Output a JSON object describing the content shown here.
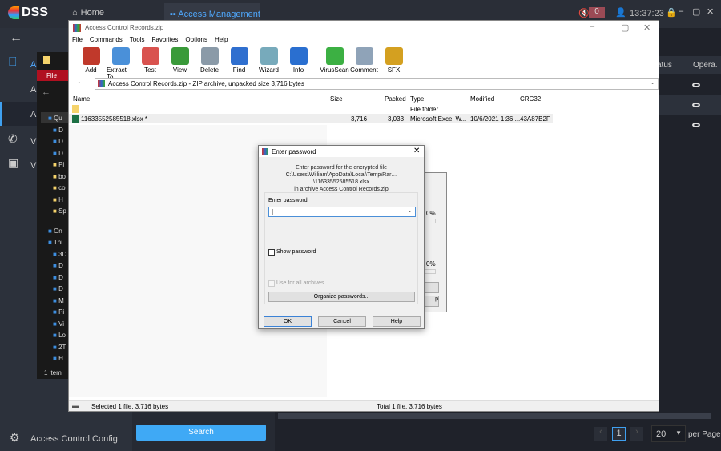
{
  "dss": {
    "logo": "DSS",
    "nav": {
      "home": "Home",
      "access": "Access Management"
    },
    "alarm_count": "0",
    "time": "13:37:23",
    "sidebar": {
      "items": [
        "A",
        "A",
        "A",
        "V",
        "V"
      ],
      "config": "Access Control Config"
    },
    "table": {
      "headers": [
        "atus",
        "Opera."
      ]
    },
    "search_label": "Search",
    "pagination": {
      "page": "1",
      "per_page_value": "20",
      "per_page_label": "per Page"
    }
  },
  "explorer": {
    "file_tab": "File",
    "status": "1 item",
    "items": [
      "Qu",
      "D",
      "D",
      "D",
      "Pi",
      "bo",
      "co",
      "H",
      "Sp",
      "On",
      "Thi",
      "3D",
      "D",
      "D",
      "D",
      "M",
      "Pi",
      "Vi",
      "Lo",
      "2T",
      "H"
    ]
  },
  "winrar": {
    "title": "Access Control Records.zip",
    "menu": [
      "File",
      "Commands",
      "Tools",
      "Favorites",
      "Options",
      "Help"
    ],
    "toolbar": [
      {
        "label": "Add",
        "color": "#c0392b"
      },
      {
        "label": "Extract To",
        "color": "#4a90d9"
      },
      {
        "label": "Test",
        "color": "#d9534f"
      },
      {
        "label": "View",
        "color": "#3a9a3a"
      },
      {
        "label": "Delete",
        "color": "#8a9aa8"
      },
      {
        "label": "Find",
        "color": "#2f6fcf"
      },
      {
        "label": "Wizard",
        "color": "#7ab"
      },
      {
        "label": "Info",
        "color": "#2a6fd0"
      },
      {
        "label": "VirusScan",
        "color": "#3cb043"
      },
      {
        "label": "Comment",
        "color": "#8fa3b8"
      },
      {
        "label": "SFX",
        "color": "#d4a020"
      }
    ],
    "address": "Access Control Records.zip - ZIP archive, unpacked size 3,716 bytes",
    "columns": [
      "Name",
      "Size",
      "Packed",
      "Type",
      "Modified",
      "CRC32"
    ],
    "rows": [
      {
        "name": "..",
        "size": "",
        "packed": "",
        "type": "File folder",
        "modified": "",
        "crc": ""
      },
      {
        "name": "11633552585518.xlsx *",
        "size": "3,716",
        "packed": "3,033",
        "type": "Microsoft Excel W...",
        "modified": "10/6/2021 1:36 ...",
        "crc": "43A87B2F"
      }
    ],
    "status_left": "Selected 1 file, 3,716 bytes",
    "status_right": "Total 1 file, 3,716 bytes"
  },
  "progress": {
    "pct1": "0%",
    "pct2": "0%"
  },
  "dialog": {
    "title": "Enter password",
    "line1": "Enter password for the encrypted file",
    "line2": "C:\\Users\\William\\AppData\\Local\\Temp\\Rar…\\11633552585518.xlsx",
    "line3": "in archive Access Control Records.zip",
    "field_label": "Enter password",
    "password_value": "",
    "show_password": "Show password",
    "use_all": "Use for all archives",
    "organize": "Organize passwords...",
    "ok": "OK",
    "cancel": "Cancel",
    "help": "Help"
  }
}
